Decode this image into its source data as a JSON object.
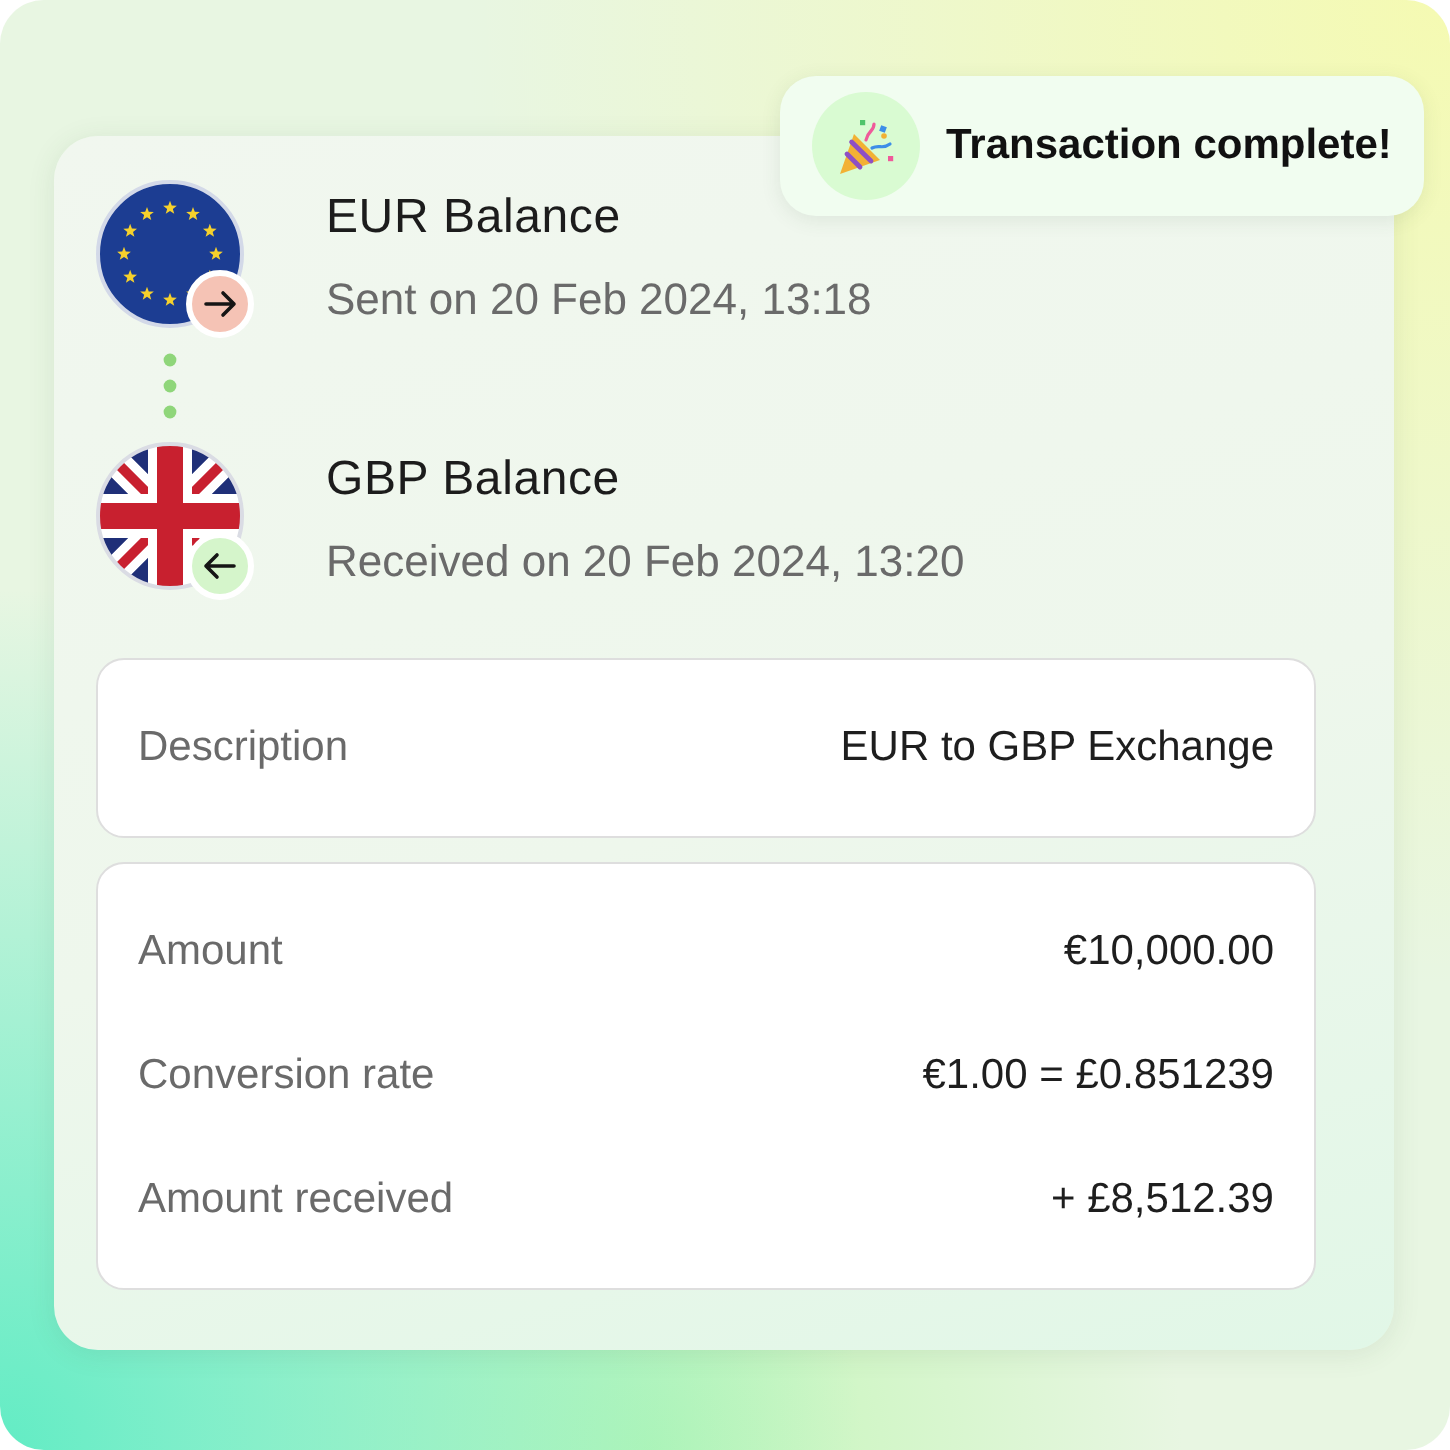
{
  "toast": {
    "text": "Transaction complete!"
  },
  "transfers": [
    {
      "kind": "sent",
      "title": "EUR Balance",
      "subtitle": "Sent on 20 Feb 2024, 13:18"
    },
    {
      "kind": "received",
      "title": "GBP Balance",
      "subtitle": "Received on 20 Feb 2024, 13:20"
    }
  ],
  "detail_cards": [
    {
      "rows": [
        {
          "label": "Description",
          "value": "EUR to GBP Exchange"
        }
      ]
    },
    {
      "rows": [
        {
          "label": "Amount",
          "value": "€10,000.00"
        },
        {
          "label": "Conversion rate",
          "value": "€1.00 = £0.851239"
        },
        {
          "label": "Amount received",
          "value": "+ £8,512.39"
        }
      ]
    }
  ]
}
